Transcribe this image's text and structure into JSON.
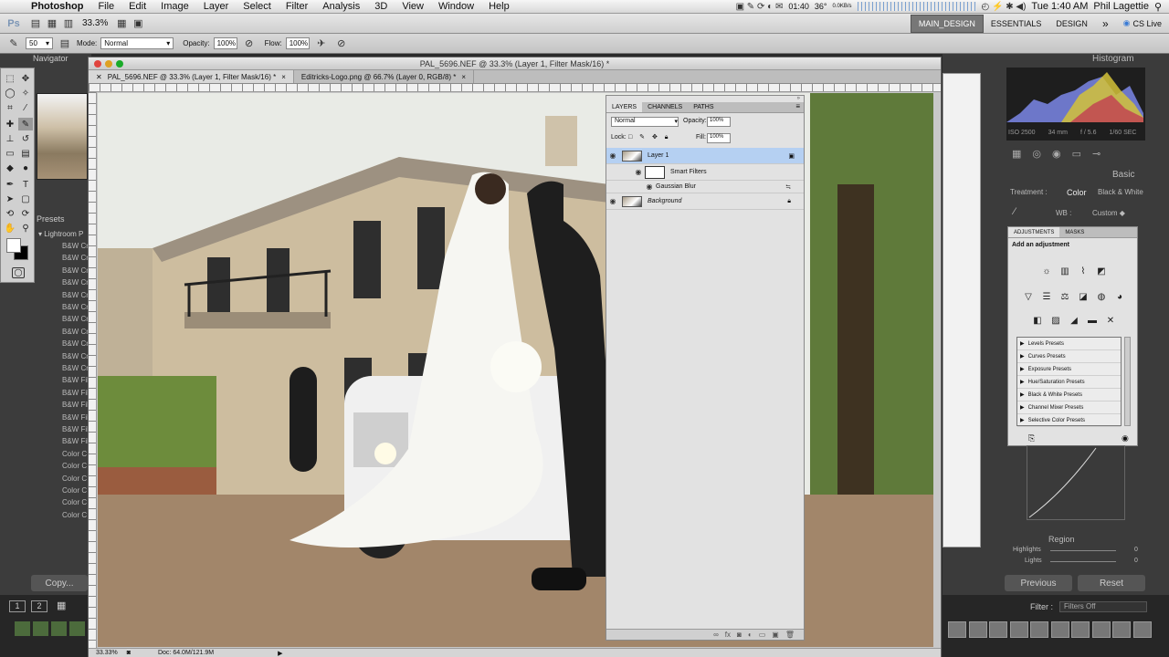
{
  "menubar": {
    "app": "Photoshop",
    "items": [
      "File",
      "Edit",
      "Image",
      "Layer",
      "Select",
      "Filter",
      "Analysis",
      "3D",
      "View",
      "Window",
      "Help"
    ],
    "status_time": "01:40",
    "temp": "36°",
    "net": "0.0KB/s",
    "datetime": "Tue 1:40 AM",
    "user": "Phil Lagettie"
  },
  "appbar": {
    "zoom": "33.3%",
    "workspaces": [
      "MAIN_DESIGN",
      "ESSENTIALS",
      "DESIGN"
    ],
    "more": "»",
    "cslive": "CS Live"
  },
  "options": {
    "mode_label": "Mode:",
    "mode_value": "Normal",
    "opacity_label": "Opacity:",
    "opacity_value": "100%",
    "flow_label": "Flow:",
    "flow_value": "100%",
    "brush_size": "50"
  },
  "left_panel": {
    "navigator": "Navigator",
    "presets": "Presets",
    "lightroom_folder": "Lightroom P",
    "preset_items": [
      "B&W Cr",
      "B&W Cr",
      "B&W Cr",
      "B&W Cr",
      "B&W Cr",
      "B&W Cr",
      "B&W Cr",
      "B&W Cr",
      "B&W Cr",
      "B&W Cr",
      "B&W Cr",
      "B&W Fil",
      "B&W Fil",
      "B&W Fil",
      "B&W Fil",
      "B&W Fil",
      "B&W Fil",
      "Color C",
      "Color C",
      "Color C",
      "Color C",
      "Color C",
      "Color C"
    ],
    "copy_button": "Copy..."
  },
  "document": {
    "title": "PAL_5696.NEF @ 33.3% (Layer 1, Filter Mask/16) *",
    "tabs": [
      "PAL_5696.NEF @ 33.3% (Layer 1, Filter Mask/16) *",
      "Editricks-Logo.png @ 66.7% (Layer 0, RGB/8) *"
    ],
    "status_zoom": "33.33%",
    "status_doc": "Doc: 64.0M/121.9M"
  },
  "layers_panel": {
    "tabs": [
      "LAYERS",
      "CHANNELS",
      "PATHS"
    ],
    "blend_mode": "Normal",
    "opacity_label": "Opacity:",
    "opacity_value": "100%",
    "lock_label": "Lock:",
    "fill_label": "Fill:",
    "fill_value": "100%",
    "layer1": "Layer 1",
    "smart_filters": "Smart Filters",
    "gaussian_blur": "Gaussian Blur",
    "background": "Background"
  },
  "right_panel": {
    "histogram_title": "Histogram",
    "iso": "ISO 2500",
    "focal": "34 mm",
    "aperture": "f / 5.6",
    "shutter": "1/60 SEC",
    "basic": "Basic",
    "treatment_label": "Treatment :",
    "treatment_color": "Color",
    "treatment_bw": "Black & White",
    "wb_label": "WB :",
    "wb_value": "Custom",
    "adj_tabs": [
      "ADJUSTMENTS",
      "MASKS"
    ],
    "add_adjustment": "Add an adjustment",
    "presets_list": [
      "Levels Presets",
      "Curves Presets",
      "Exposure Presets",
      "Hue/Saturation Presets",
      "Black & White Presets",
      "Channel Mixer Presets",
      "Selective Color Presets"
    ],
    "region": "Region",
    "highlights": "Highlights",
    "highlights_value": "0",
    "lights": "Lights",
    "lights_value": "0",
    "previous": "Previous",
    "reset": "Reset",
    "filter_label": "Filter :",
    "filter_value": "Filters Off"
  }
}
